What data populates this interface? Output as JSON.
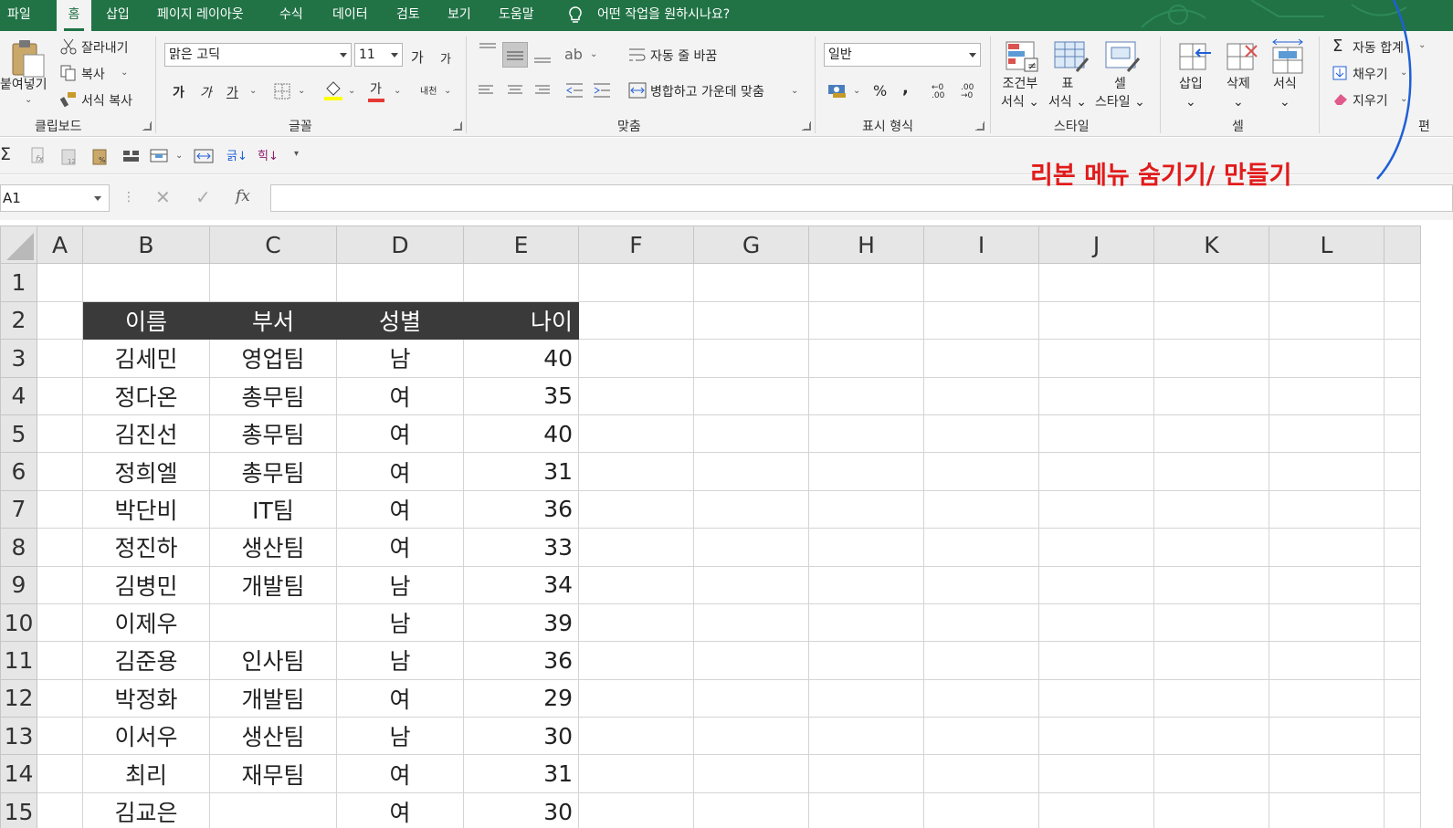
{
  "menu": {
    "tabs": [
      "파일",
      "홈",
      "삽입",
      "페이지 레이아웃",
      "수식",
      "데이터",
      "검토",
      "보기",
      "도움말"
    ],
    "active": "홈",
    "tell_me": "어떤 작업을 원하시나요?"
  },
  "ribbon": {
    "clipboard": {
      "paste": "붙여넣기",
      "cut": "잘라내기",
      "copy": "복사",
      "format_painter": "서식 복사",
      "group": "클립보드"
    },
    "font": {
      "name": "맑은 고딕",
      "size": "11",
      "grow": "가",
      "shrink": "가",
      "bold": "가",
      "italic": "가",
      "underline": "가",
      "font_color": "가",
      "phonetic": "내천",
      "group": "글꼴"
    },
    "alignment": {
      "wrap": "자동 줄 바꿈",
      "merge": "병합하고 가운데 맞춤",
      "group": "맞춤"
    },
    "number": {
      "format": "일반",
      "percent": "%",
      "comma": ",",
      "group": "표시 형식"
    },
    "styles": {
      "conditional": [
        "조건부",
        "서식"
      ],
      "table": [
        "표",
        "서식"
      ],
      "cell": [
        "셀",
        "스타일"
      ],
      "group": "스타일"
    },
    "cells": {
      "insert": "삽입",
      "delete": "삭제",
      "format": "서식",
      "group": "셀"
    },
    "editing": {
      "autosum": "자동 합계",
      "fill": "채우기",
      "clear": "지우기",
      "group": "편"
    }
  },
  "formula_bar": {
    "name_box": "A1",
    "fx": "fx",
    "value": ""
  },
  "annotation": "리본 메뉴 숨기기/ 만들기",
  "sheet": {
    "columns": [
      "A",
      "B",
      "C",
      "D",
      "E",
      "F",
      "G",
      "H",
      "I",
      "J",
      "K",
      "L"
    ],
    "header_row": {
      "row": "2",
      "cells": [
        "이름",
        "부서",
        "성별",
        "나이"
      ]
    },
    "rows": [
      {
        "row": "1",
        "name": "",
        "dept": "",
        "gender": "",
        "age": ""
      },
      {
        "row": "3",
        "name": "김세민",
        "dept": "영업팀",
        "gender": "남",
        "age": "40"
      },
      {
        "row": "4",
        "name": "정다온",
        "dept": "총무팀",
        "gender": "여",
        "age": "35"
      },
      {
        "row": "5",
        "name": "김진선",
        "dept": "총무팀",
        "gender": "여",
        "age": "40"
      },
      {
        "row": "6",
        "name": "정희엘",
        "dept": "총무팀",
        "gender": "여",
        "age": "31"
      },
      {
        "row": "7",
        "name": "박단비",
        "dept": "IT팀",
        "gender": "여",
        "age": "36"
      },
      {
        "row": "8",
        "name": "정진하",
        "dept": "생산팀",
        "gender": "여",
        "age": "33"
      },
      {
        "row": "9",
        "name": "김병민",
        "dept": "개발팀",
        "gender": "남",
        "age": "34"
      },
      {
        "row": "10",
        "name": "이제우",
        "dept": "",
        "gender": "남",
        "age": "39"
      },
      {
        "row": "11",
        "name": "김준용",
        "dept": "인사팀",
        "gender": "남",
        "age": "36"
      },
      {
        "row": "12",
        "name": "박정화",
        "dept": "개발팀",
        "gender": "여",
        "age": "29"
      },
      {
        "row": "13",
        "name": "이서우",
        "dept": "생산팀",
        "gender": "남",
        "age": "30"
      },
      {
        "row": "14",
        "name": "최리",
        "dept": "재무팀",
        "gender": "여",
        "age": "31"
      },
      {
        "row": "15",
        "name": "김교은",
        "dept": "",
        "gender": "여",
        "age": "30"
      }
    ]
  },
  "colors": {
    "excel_green": "#217346",
    "header_fill": "#3a3a3a",
    "annotation_red": "#e11b1b",
    "curve_blue": "#1f5fd6"
  }
}
